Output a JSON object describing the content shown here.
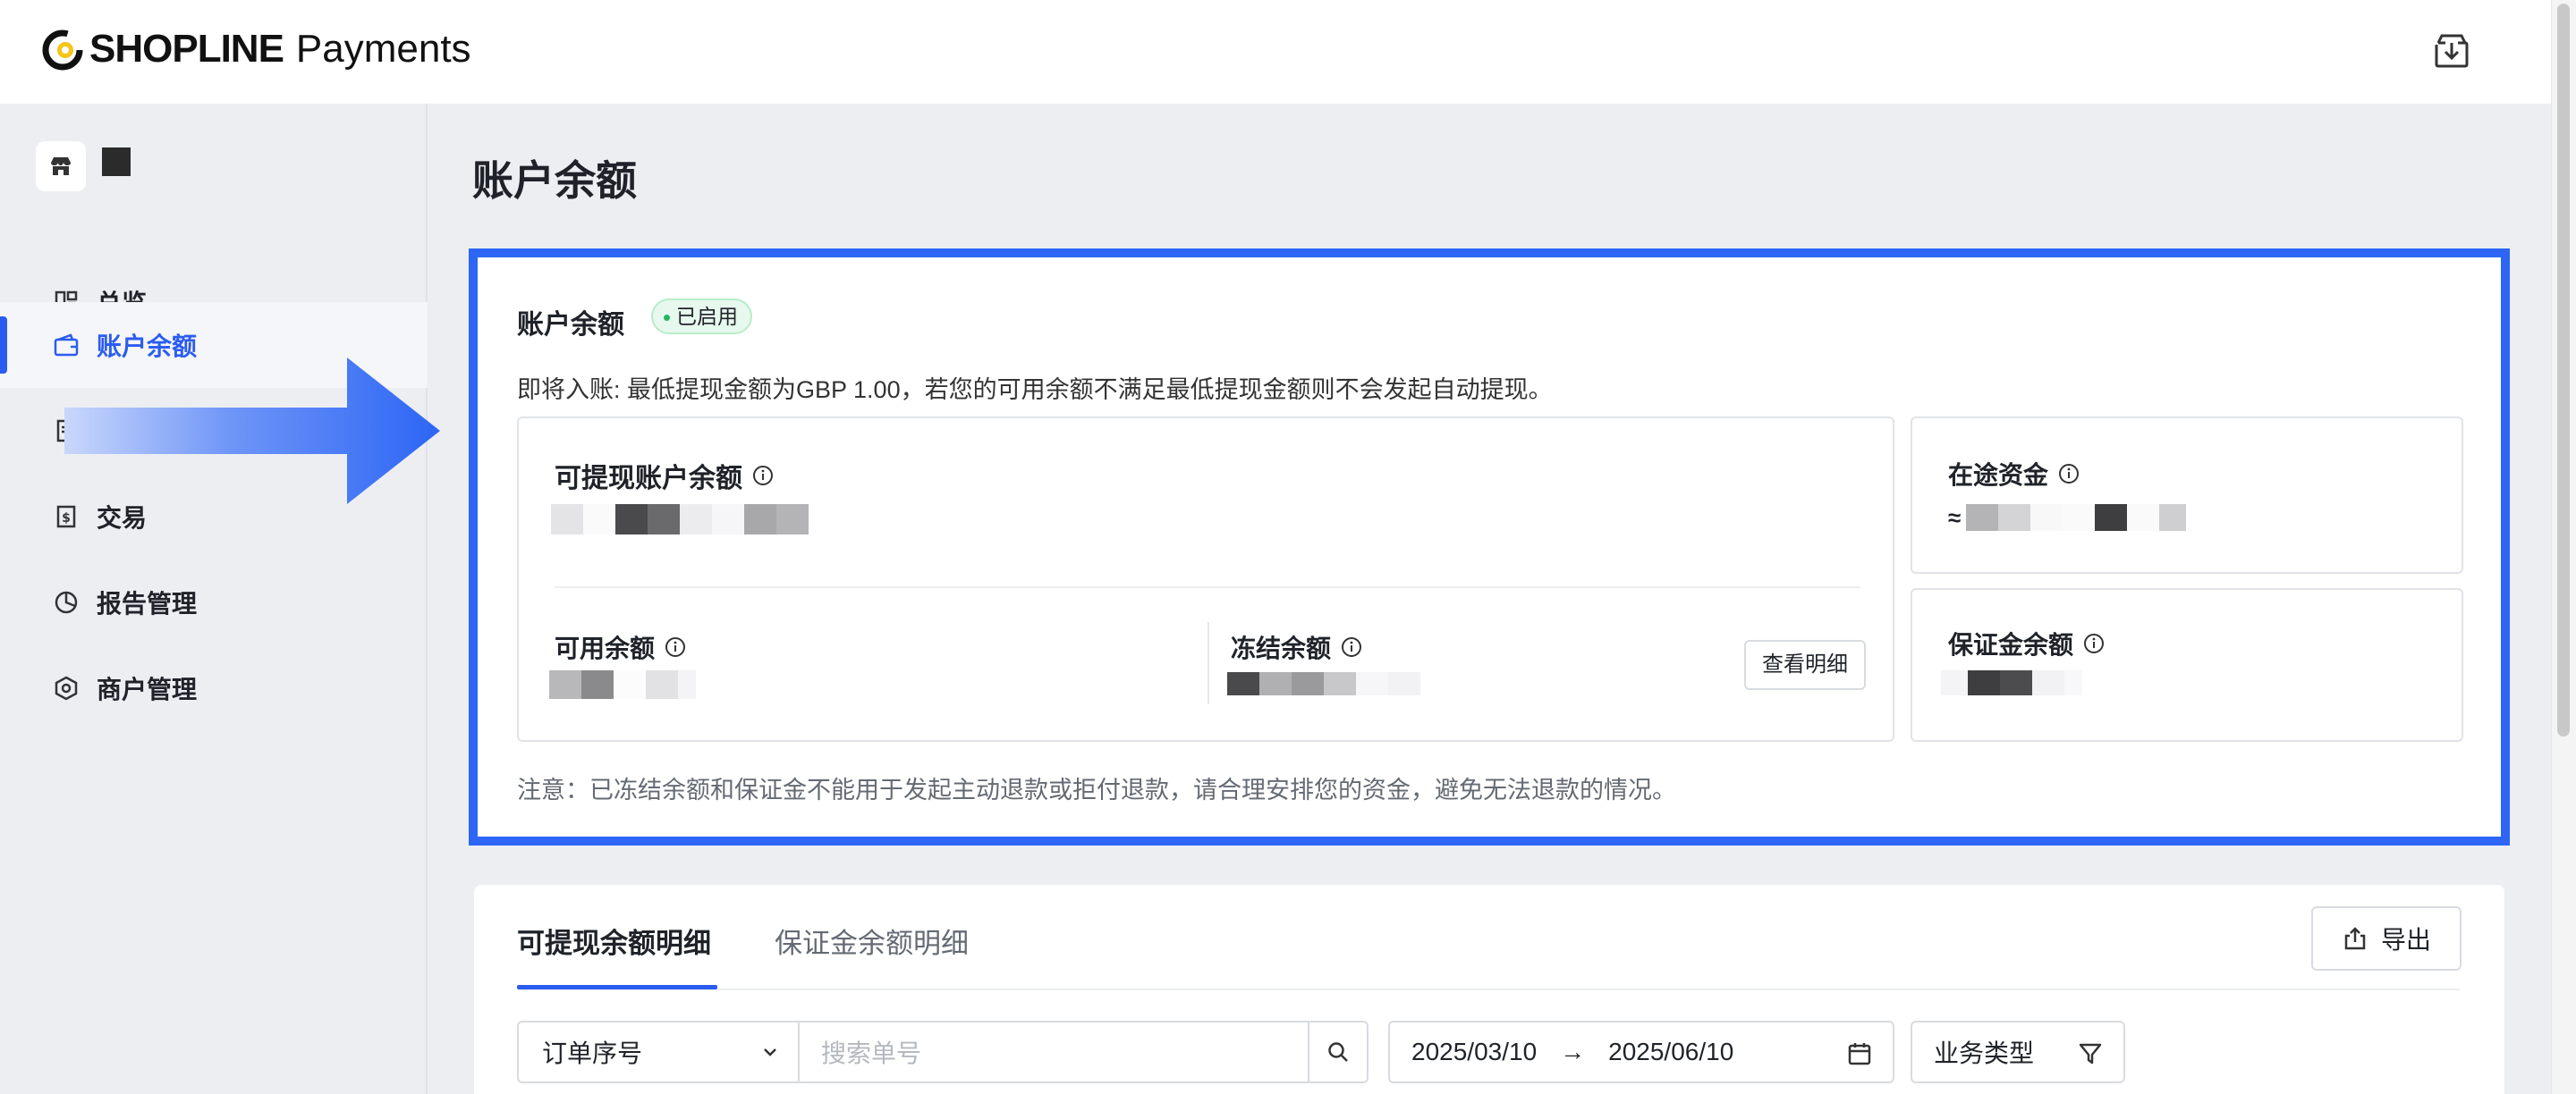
{
  "brand": {
    "name": "SHOPLINE",
    "product": "Payments",
    "accent": "#f5c518"
  },
  "colors": {
    "primary": "#2b5cf0",
    "highlight_border": "#2d66f5",
    "success": "#27b562"
  },
  "sidebar": {
    "items": [
      {
        "label": "总览",
        "icon": "overview-icon"
      },
      {
        "label": "账户余额",
        "icon": "wallet-icon",
        "active": true
      },
      {
        "label": "",
        "icon": "document-icon"
      },
      {
        "label": "交易",
        "icon": "transaction-icon"
      },
      {
        "label": "报告管理",
        "icon": "report-icon"
      },
      {
        "label": "商户管理",
        "icon": "merchant-icon"
      }
    ]
  },
  "page": {
    "title": "账户余额"
  },
  "balance_card": {
    "title": "账户余额",
    "status_badge": "已启用",
    "note": "即将入账: 最低提现金额为GBP 1.00，若您的可用余额不满足最低提现金额则不会发起自动提现。",
    "withdrawable_label": "可提现账户余额",
    "available_label": "可用余额",
    "frozen_label": "冻结余额",
    "view_detail_button": "查看明细",
    "in_transit_label": "在途资金",
    "in_transit_prefix": "≈",
    "deposit_label": "保证金余额",
    "footer_note": "注意：已冻结余额和保证金不能用于发起主动退款或拒付退款，请合理安排您的资金，避免无法退款的情况。"
  },
  "details": {
    "tabs": [
      {
        "label": "可提现余额明细",
        "active": true
      },
      {
        "label": "保证金余额明细",
        "active": false
      }
    ],
    "export_button": "导出",
    "filter": {
      "select_value": "订单序号",
      "search_placeholder": "搜索单号",
      "date_start": "2025/03/10",
      "date_separator": "→",
      "date_end": "2025/06/10",
      "business_type": "业务类型"
    }
  }
}
